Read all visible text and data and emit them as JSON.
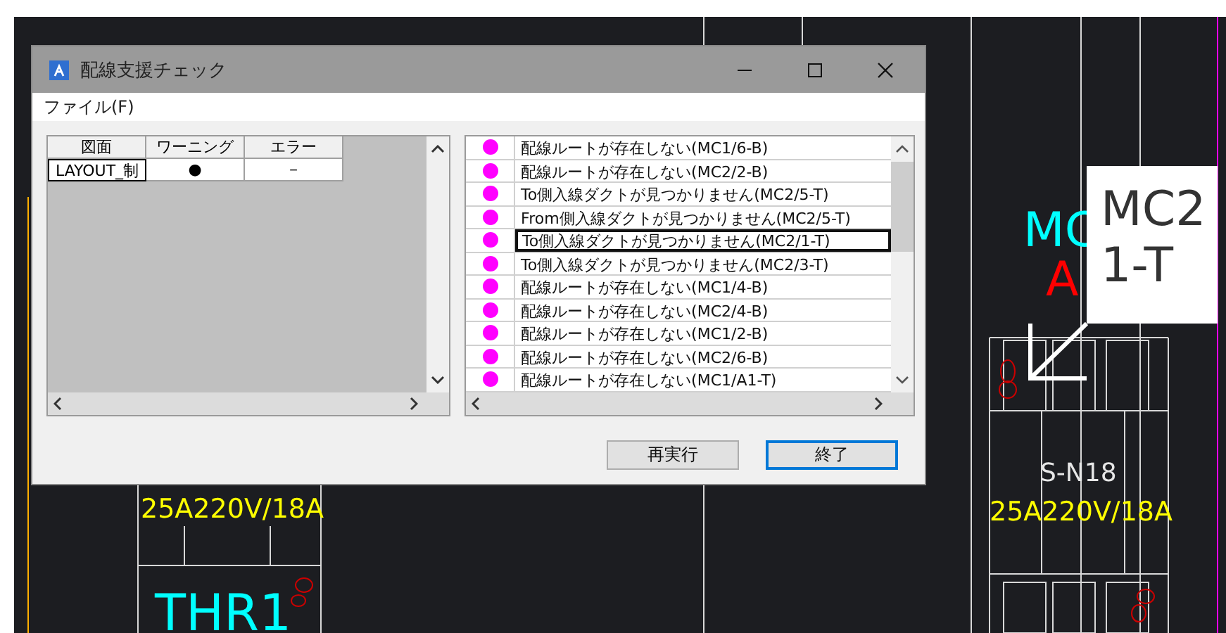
{
  "window": {
    "title": "配線支援チェック"
  },
  "menu": [
    {
      "label": "ファイル(F)"
    }
  ],
  "drawings_table": {
    "columns": [
      "図面",
      "ワーニング",
      "エラー"
    ],
    "rows": [
      {
        "cells": [
          "LAYOUT_制",
          "●",
          "－"
        ],
        "selected": true
      }
    ]
  },
  "messages": [
    {
      "color": "#ff00ff",
      "text": "配線ルートが存在しない(MC1/6-B)",
      "selected": false
    },
    {
      "color": "#ff00ff",
      "text": "配線ルートが存在しない(MC2/2-B)",
      "selected": false
    },
    {
      "color": "#ff00ff",
      "text": "To側入線ダクトが見つかりません(MC2/5-T)",
      "selected": false
    },
    {
      "color": "#ff00ff",
      "text": "From側入線ダクトが見つかりません(MC2/5-T)",
      "selected": false
    },
    {
      "color": "#ff00ff",
      "text": "To側入線ダクトが見つかりません(MC2/1-T)",
      "selected": true
    },
    {
      "color": "#ff00ff",
      "text": "To側入線ダクトが見つかりません(MC2/3-T)",
      "selected": false
    },
    {
      "color": "#ff00ff",
      "text": "配線ルートが存在しない(MC1/4-B)",
      "selected": false
    },
    {
      "color": "#ff00ff",
      "text": "配線ルートが存在しない(MC2/4-B)",
      "selected": false
    },
    {
      "color": "#ff00ff",
      "text": "配線ルートが存在しない(MC1/2-B)",
      "selected": false
    },
    {
      "color": "#ff00ff",
      "text": "配線ルートが存在しない(MC2/6-B)",
      "selected": false
    },
    {
      "color": "#ff00ff",
      "text": "配線ルートが存在しない(MC1/A1-T)",
      "selected": false
    }
  ],
  "buttons": [
    {
      "label": "再実行",
      "default": false
    },
    {
      "label": "終了",
      "default": true
    }
  ],
  "cad": {
    "labels": [
      {
        "text": "MC",
        "color": "#00ffff"
      },
      {
        "text": "A",
        "color": "#ff0000"
      },
      {
        "text": "S-N18",
        "color": "#e6e6e6"
      },
      {
        "text": "25A220V/18A",
        "color": "#ffff00"
      },
      {
        "text": "25A220V/18A",
        "color": "#ffff00"
      },
      {
        "text": "THR1",
        "color": "#00ffff"
      }
    ],
    "callout": {
      "lines": [
        "MC2",
        "1-T"
      ]
    }
  }
}
